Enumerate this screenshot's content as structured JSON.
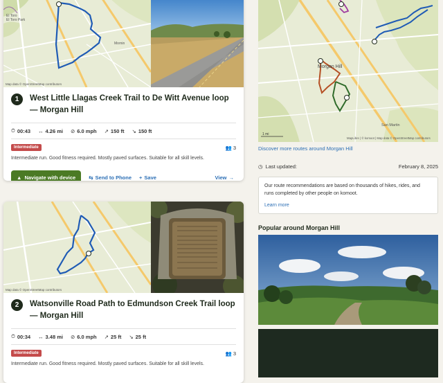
{
  "routes": [
    {
      "number": "1",
      "title": "West Little Llagas Creek Trail to De Witt Avenue loop — Morgan Hill",
      "duration": "00:43",
      "distance": "4.26 mi",
      "speed": "6.0 mph",
      "uphill": "150 ft",
      "downhill": "150 ft",
      "difficulty": "Intermediate",
      "people": "3",
      "description": "Intermediate run. Good fitness required. Mostly paved surfaces. Suitable for all skill levels.",
      "map_attribution": "Map data © OpenStreetMap contributors",
      "map_labels": [
        "El Toro",
        "El Toro Park",
        "Mornin"
      ]
    },
    {
      "number": "2",
      "title": "Watsonville Road Path to Edmundson Creek Trail loop — Morgan Hill",
      "duration": "00:34",
      "distance": "3.48 mi",
      "speed": "6.0 mph",
      "uphill": "25 ft",
      "downhill": "25 ft",
      "difficulty": "Intermediate",
      "people": "3",
      "description": "Intermediate run. Good fitness required. Mostly paved surfaces. Suitable for all skill levels.",
      "map_attribution": "Map data © OpenStreetMap contributors",
      "map_labels": []
    }
  ],
  "actions": {
    "navigate": "Navigate with device",
    "send": "Send to Phone",
    "save": "Save",
    "view": "View"
  },
  "sidebar": {
    "map_labels": [
      "Morgan Hill",
      "San Martin"
    ],
    "map_attribution": "MapLibre | © komoot | Map data © OpenStreetMap contributors",
    "scale_label": "1 mi",
    "discover": "Discover more routes around Morgan Hill",
    "last_updated_label": "Last updated:",
    "last_updated_date": "February 8, 2025",
    "info_text": "Our route recommendations are based on thousands of hikes, rides, and runs completed by other people on komoot.",
    "learn_more": "Learn more",
    "popular_heading": "Popular around Morgan Hill"
  },
  "colors": {
    "accent_green": "#4b7a25",
    "link_blue": "#2c6fb5",
    "badge_red": "#c44b4b",
    "route_blue": "#1f5bb5"
  }
}
